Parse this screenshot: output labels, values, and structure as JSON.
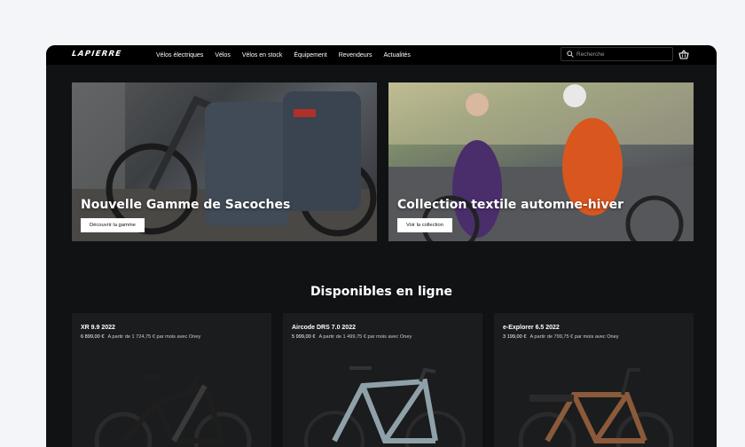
{
  "nav": {
    "logo": "LAPIERRE",
    "items": [
      "Vélos électriques",
      "Vélos",
      "Vélos en stock",
      "Équipement",
      "Revendeurs",
      "Actualités"
    ],
    "search_placeholder": "Recherche",
    "icons": {
      "search": "search-icon",
      "cart": "basket-icon"
    }
  },
  "heroes": [
    {
      "title": "Nouvelle Gamme de Sacoches",
      "button": "Découvrir la gamme"
    },
    {
      "title": "Collection textile automne-hiver",
      "button": "Voir la collection"
    }
  ],
  "section": {
    "title": "Disponibles en ligne"
  },
  "products": [
    {
      "name": "XR 9.9 2022",
      "price": "6 899,00 €",
      "financing": "A partir de 1 724,75 € par mois avec Oney"
    },
    {
      "name": "Aircode DRS 7.0 2022",
      "price": "5 999,00 €",
      "financing": "A partir de 1 499,75 € par mois avec Oney"
    },
    {
      "name": "e-Explorer 6.5 2022",
      "price": "3 199,00 €",
      "financing": "A partir de 799,75 € par mois avec Oney"
    }
  ],
  "colors": {
    "page_bg": "#f4f5f8",
    "site_bg": "#111213",
    "nav_bg": "#000000",
    "card_bg": "#1b1c1d"
  }
}
